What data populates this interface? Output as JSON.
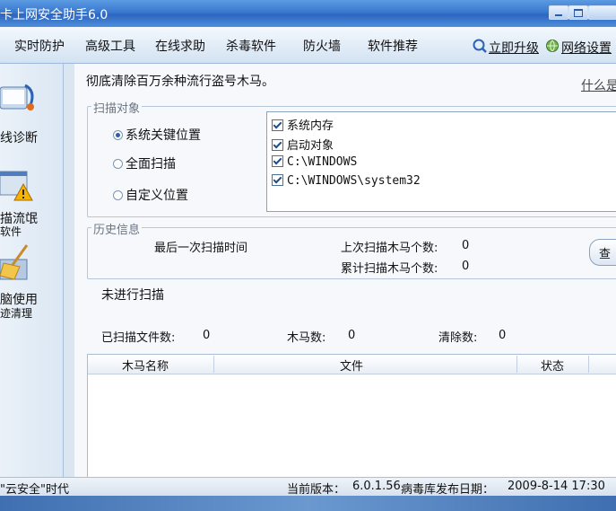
{
  "window": {
    "title": "卡上网安全助手6.0"
  },
  "menu": {
    "items": [
      "实时防护",
      "高级工具",
      "在线求助",
      "杀毒软件",
      "防火墙",
      "软件推荐"
    ],
    "upgrade_label": "立即升级",
    "network_label": "网络设置"
  },
  "sidebar": {
    "items": [
      {
        "label": "线诊断",
        "icon": "diagnosis-icon"
      },
      {
        "label_line1": "描流氓",
        "label_line2": "软件",
        "icon": "warning-icon"
      },
      {
        "label_line1": "脑使用",
        "label_line2": "迹清理",
        "icon": "broom-icon"
      }
    ]
  },
  "main": {
    "tagline": "彻底清除百万余种流行盗号木马。",
    "whats_link": "什么是",
    "scan_target": {
      "legend": "扫描对象",
      "options": [
        "系统关键位置",
        "全面扫描",
        "自定义位置"
      ],
      "selected": "系统关键位置",
      "locations": [
        "系统内存",
        "启动对象",
        "C:\\WINDOWS",
        "C:\\WINDOWS\\system32"
      ]
    },
    "history": {
      "legend": "历史信息",
      "last_scan_label": "最后一次扫描时间",
      "last_trojans_label": "上次扫描木马个数:",
      "last_trojans_value": "0",
      "total_trojans_label": "累计扫描木马个数:",
      "total_trojans_value": "0",
      "button_label": "查"
    },
    "status_message": "未进行扫描",
    "stats": {
      "files_label": "已扫描文件数:",
      "files_value": "0",
      "trojans_label": "木马数:",
      "trojans_value": "0",
      "cleared_label": "清除数:",
      "cleared_value": "0"
    },
    "results_table": {
      "columns": [
        "木马名称",
        "文件",
        "状态"
      ],
      "rows": []
    }
  },
  "statusbar": {
    "slogan": "\"云安全\"时代",
    "version_label": "当前版本：",
    "version_value": "6.0.1.56",
    "db_date_label": "病毒库发布日期：",
    "db_date_value": "2009-8-14 17:30"
  },
  "colors": {
    "titlebar": "#3a78cf",
    "accent": "#2d5fa8",
    "panel_bg": "#f6f8fb"
  }
}
